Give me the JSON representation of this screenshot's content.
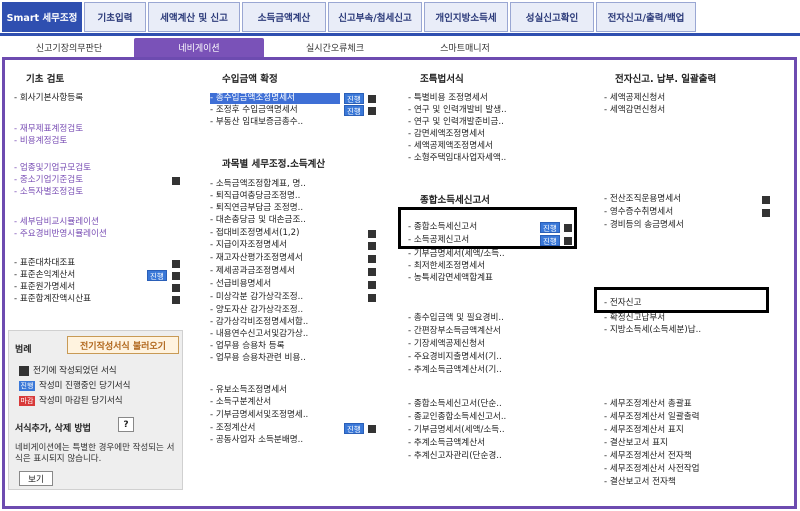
{
  "top_tabs": [
    "Smart 세무조정",
    "기초입력",
    "세액계산 및 신고",
    "소득금액계산",
    "신고부속/첨세신고",
    "개인지방소득세",
    "성실신고확인",
    "전자신고/출력/백업"
  ],
  "sub_tabs": [
    "신고기장의무판단",
    "네비게이션",
    "실시간오류체크",
    "스마트매니저"
  ],
  "col1": {
    "title": "기초 검토",
    "items": [
      "회사기본사항등록",
      "재무제표계정검토",
      "비용계정검토",
      "업종및기업규모검토",
      "중소기업기준검토",
      "소득자별조정검토",
      "세부담비교시뮬레이션",
      "주요경비반영시뮬레이션",
      "표준대차대조표",
      "표준손익계산서",
      "표준원가명세서",
      "표준합계잔액시산표"
    ]
  },
  "col2": {
    "title": "수입금액 확정",
    "items": [
      "총수입금액조정명세서",
      "조정후 수입금액명세서",
      "부동산 임대보증금총수.."
    ],
    "title2": "과목별 세무조정.소득계산",
    "items2": [
      "소득금액조정합계표, 명..",
      "퇴직급여충당금조정명..",
      "퇴직연금부담금 조정명..",
      "대손충당금 및 대손금조..",
      "접대비조정명세서(1,2)",
      "지급이자조정명세서",
      "재고자산평가조정명세서",
      "제세공과금조정명세서",
      "선급비용명세서",
      "미상각분 감가상각조정..",
      "양도자산 감가상각조정..",
      "감가상각비조정명세서합..",
      "내용연수신고서및감가상..",
      "업무용 승용차 등록",
      "업무용 승용차관련 비용..",
      "유보소득조정명세서",
      "소득구분계산서",
      "기부금명세서및조정명세..",
      "조정계산서",
      "공동사업자 소득분배명.."
    ]
  },
  "col3": {
    "title": "조특법서식",
    "items": [
      "특별비용 조정명세서",
      "연구 및 인력개발비 발생..",
      "연구 및 인력개발준비금..",
      "감면세액조정명세서",
      "세액공제액조정명세서",
      "소형주택임대사업자세액.."
    ],
    "title2": "종합소득세신고서",
    "items2": [
      "종합소득세신고서",
      "소득공제신고서",
      "기부금명세서(세액/소득..",
      "최저한세조정명세서",
      "농특세감면세액합계표",
      "총수입금액 및 필요경비..",
      "간편장부소득금액계산서",
      "기장세액공제신청서",
      "주요경비지출명세서(기..",
      "추계소득금액계산서(기..",
      "종합소득세신고서(단순..",
      "종교인종합소득세신고서..",
      "기부금명세서(세액/소득..",
      "추계소득금액계산서",
      "추계신고자관리(단순경.."
    ]
  },
  "col4": {
    "title": "전자신고. 납부. 일괄출력",
    "items": [
      "세액공제신청서",
      "세액감면신청서",
      "전산조직운용명세서",
      "영수증수취명세서",
      "경비등의 송금명세서",
      "전자신고",
      "확정신고납부서",
      "지방소득세(소득세분)납..",
      "세무조정계산서 총괄표",
      "세무조정계산서 일괄출력",
      "세무조정계산서 표지",
      "결산보고서 표지",
      "세무조정계산서 전자책",
      "세무조정계산서 사전작업",
      "결산보고서 전자책"
    ]
  },
  "badge_label": "진행",
  "legend": {
    "title": "범례",
    "load_button": "전기작성서식 불러오기",
    "rows": [
      "전기에 작성되었던 서식",
      "작성미 진행중인 당기서식",
      "작성미 마감된 당기서식"
    ],
    "key_progress": "진행",
    "key_closed": "마감",
    "section": "서식추가, 삭제 방법",
    "help": "?",
    "note": "네비게이션에는 특별한 경우에만 작성되는 서식은 표시되지 않습니다.",
    "view": "보기"
  },
  "colors": {
    "primary": "#2f4fb0",
    "frame": "#6d4bb0",
    "purple_text": "#7a4fb5",
    "badge": "#3a78d8",
    "closed": "#d83a3a"
  }
}
